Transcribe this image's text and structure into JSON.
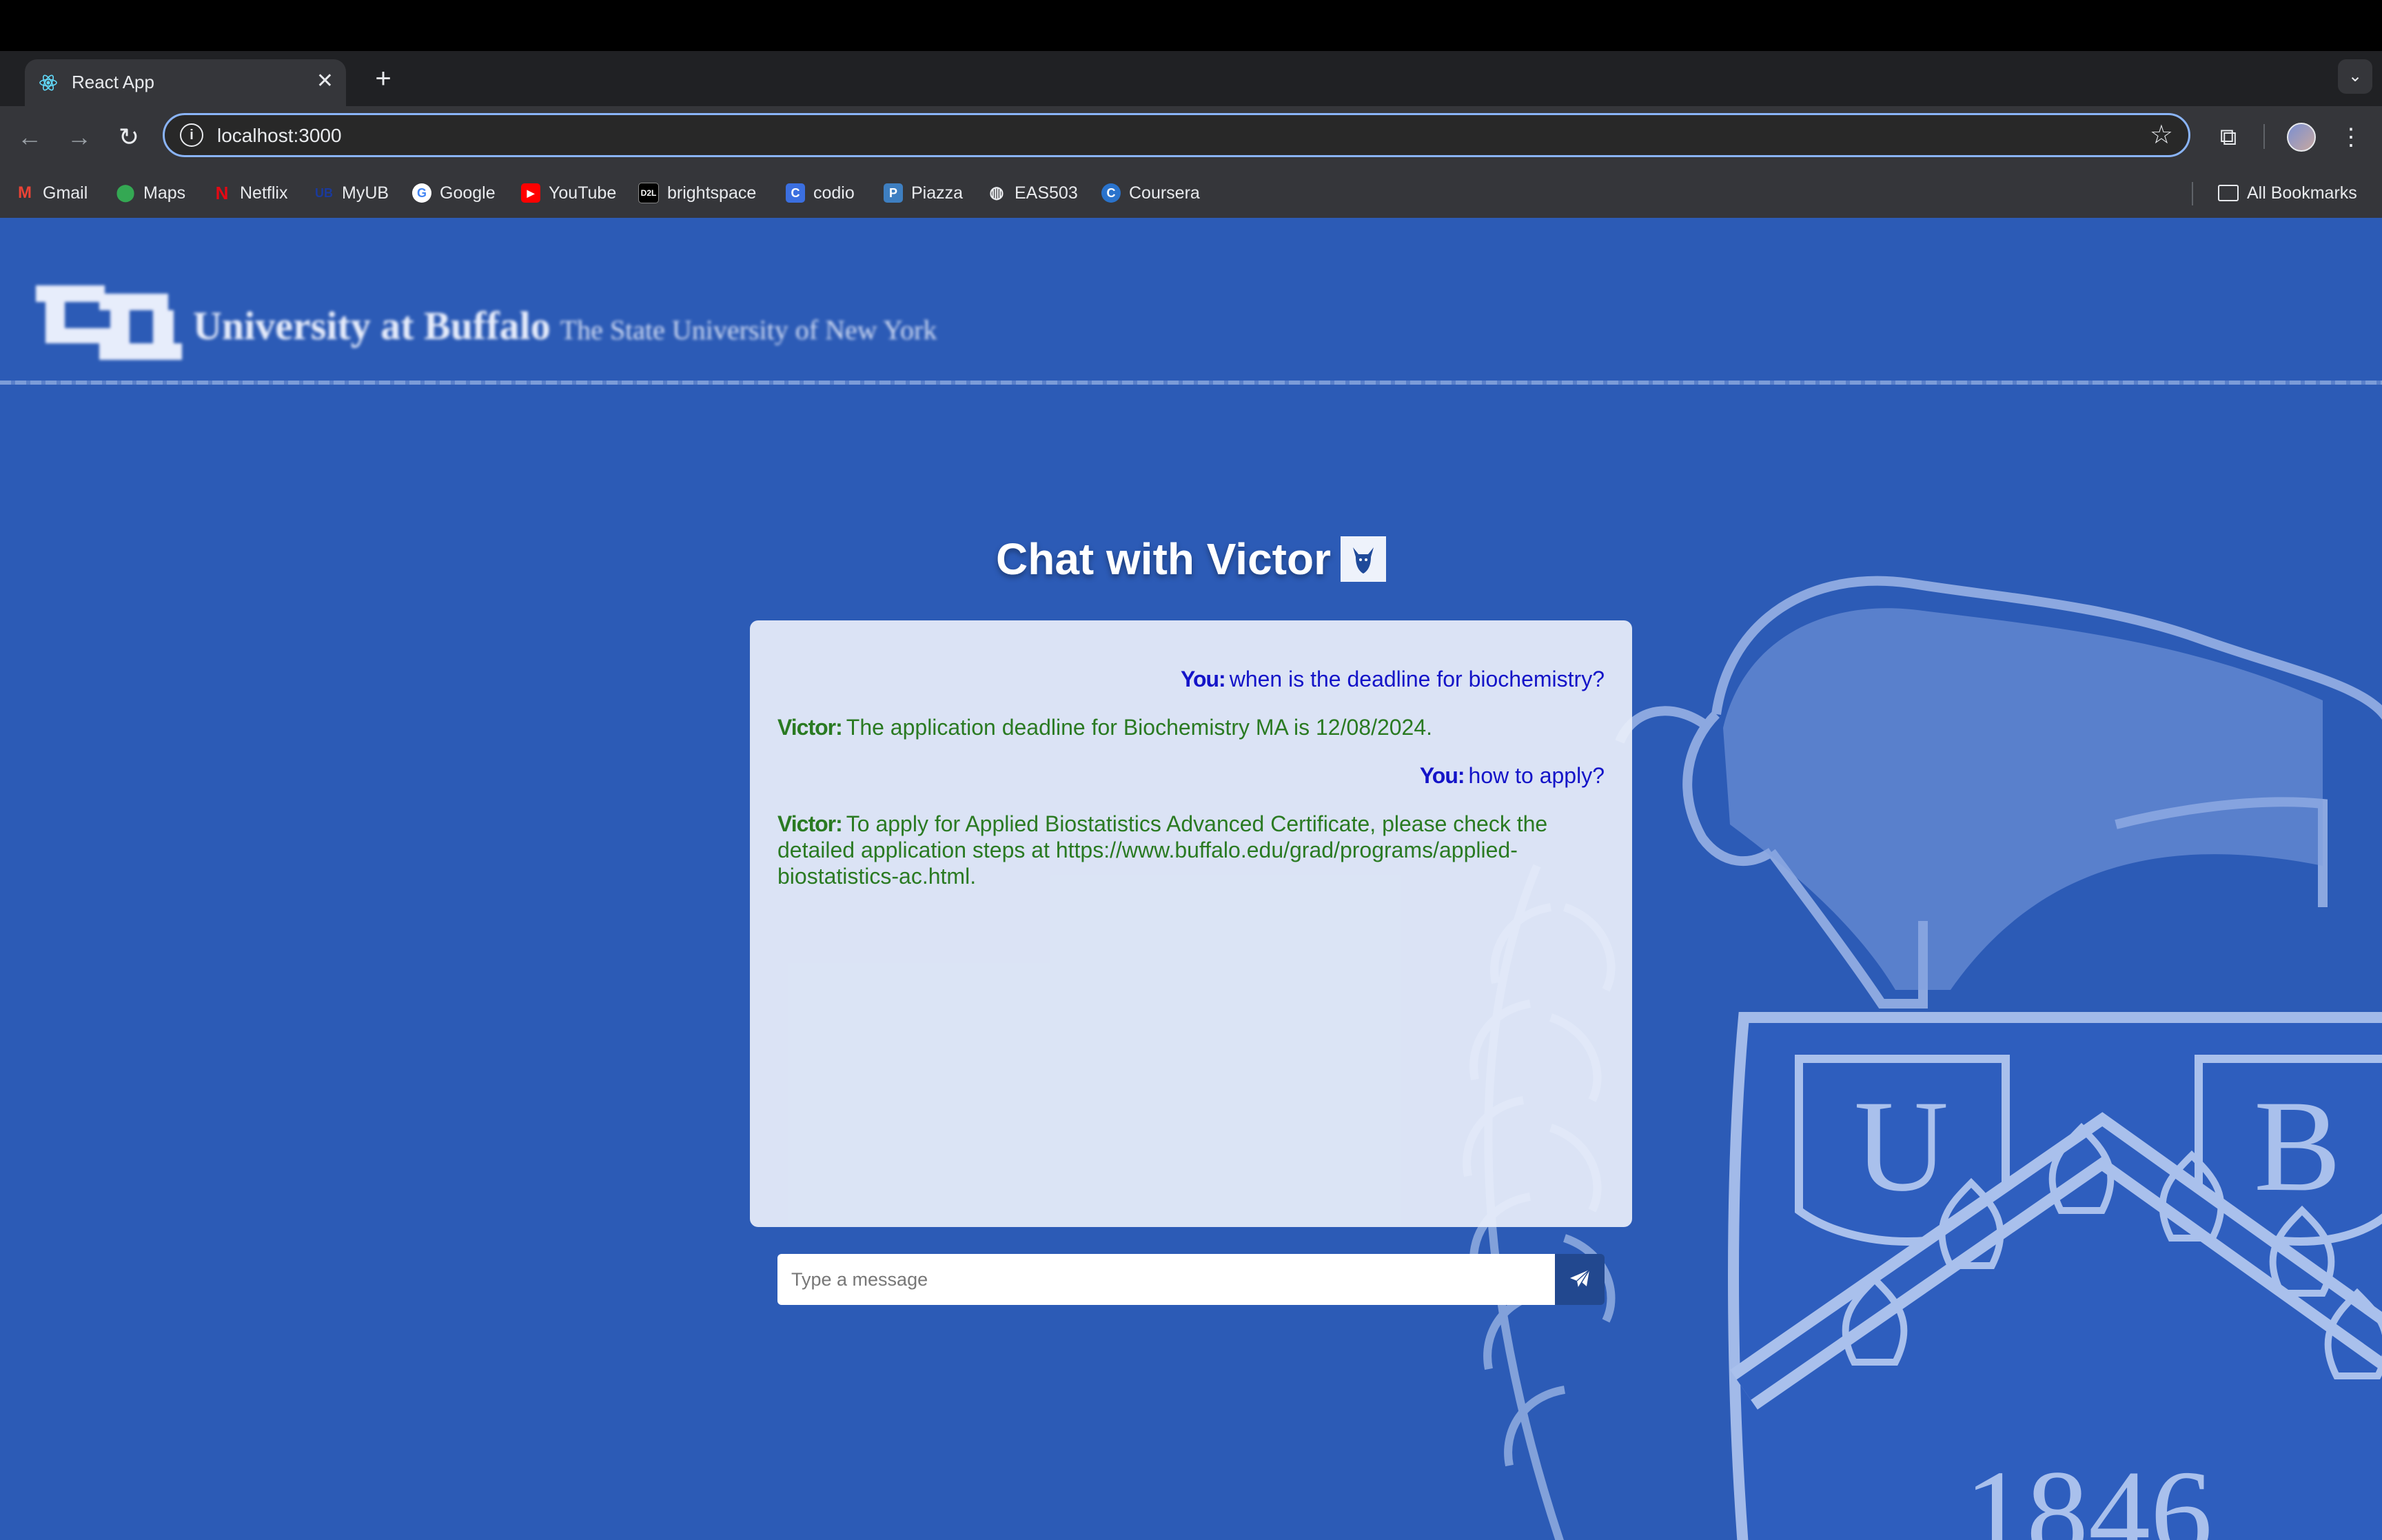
{
  "browser": {
    "tab_title": "React App",
    "tab_close": "✕",
    "new_tab": "+",
    "url": "localhost:3000",
    "bookmarks": [
      {
        "label": "Gmail",
        "icon": "gmail-icon",
        "color": "#ea4335"
      },
      {
        "label": "Maps",
        "icon": "maps-icon",
        "color": "#34a853"
      },
      {
        "label": "Netflix",
        "icon": "netflix-icon",
        "color": "#e50914"
      },
      {
        "label": "MyUB",
        "icon": "myub-icon",
        "color": "#1a3a9c"
      },
      {
        "label": "Google",
        "icon": "google-icon",
        "color": "#ffffff"
      },
      {
        "label": "YouTube",
        "icon": "youtube-icon",
        "color": "#ff0000"
      },
      {
        "label": "brightspace",
        "icon": "d2l-icon",
        "color": "#000000"
      },
      {
        "label": "codio",
        "icon": "codio-icon",
        "color": "#3b6fe0"
      },
      {
        "label": "Piazza",
        "icon": "piazza-icon",
        "color": "#3e7fc1"
      },
      {
        "label": "EAS503",
        "icon": "globe-icon",
        "color": "#9aa0a6"
      },
      {
        "label": "Coursera",
        "icon": "coursera-icon",
        "color": "#2a73cc"
      }
    ],
    "all_bookmarks": "All Bookmarks"
  },
  "header": {
    "brand": "University at Buffalo",
    "subtitle": "The State University of New York"
  },
  "chat": {
    "title": "Chat with Victor",
    "messages": [
      {
        "role": "user",
        "sender": "You:",
        "text": "when is the deadline for biochemistry?"
      },
      {
        "role": "bot",
        "sender": "Victor:",
        "text": "The application deadline for Biochemistry MA is 12/08/2024."
      },
      {
        "role": "user",
        "sender": "You:",
        "text": "how to apply?"
      },
      {
        "role": "bot",
        "sender": "Victor:",
        "text": "To apply for Applied Biostatistics Advanced Certificate, please check the detailed application steps at https://www.buffalo.edu/grad/programs/applied-biostatistics-ac.html."
      }
    ],
    "input_placeholder": "Type a message",
    "input_value": ""
  },
  "seal": {
    "year": "1846"
  },
  "colors": {
    "page_bg": "#2c5bb6",
    "user_text": "#1414c8",
    "bot_text": "#2a7a22",
    "send_button": "#22488f"
  }
}
